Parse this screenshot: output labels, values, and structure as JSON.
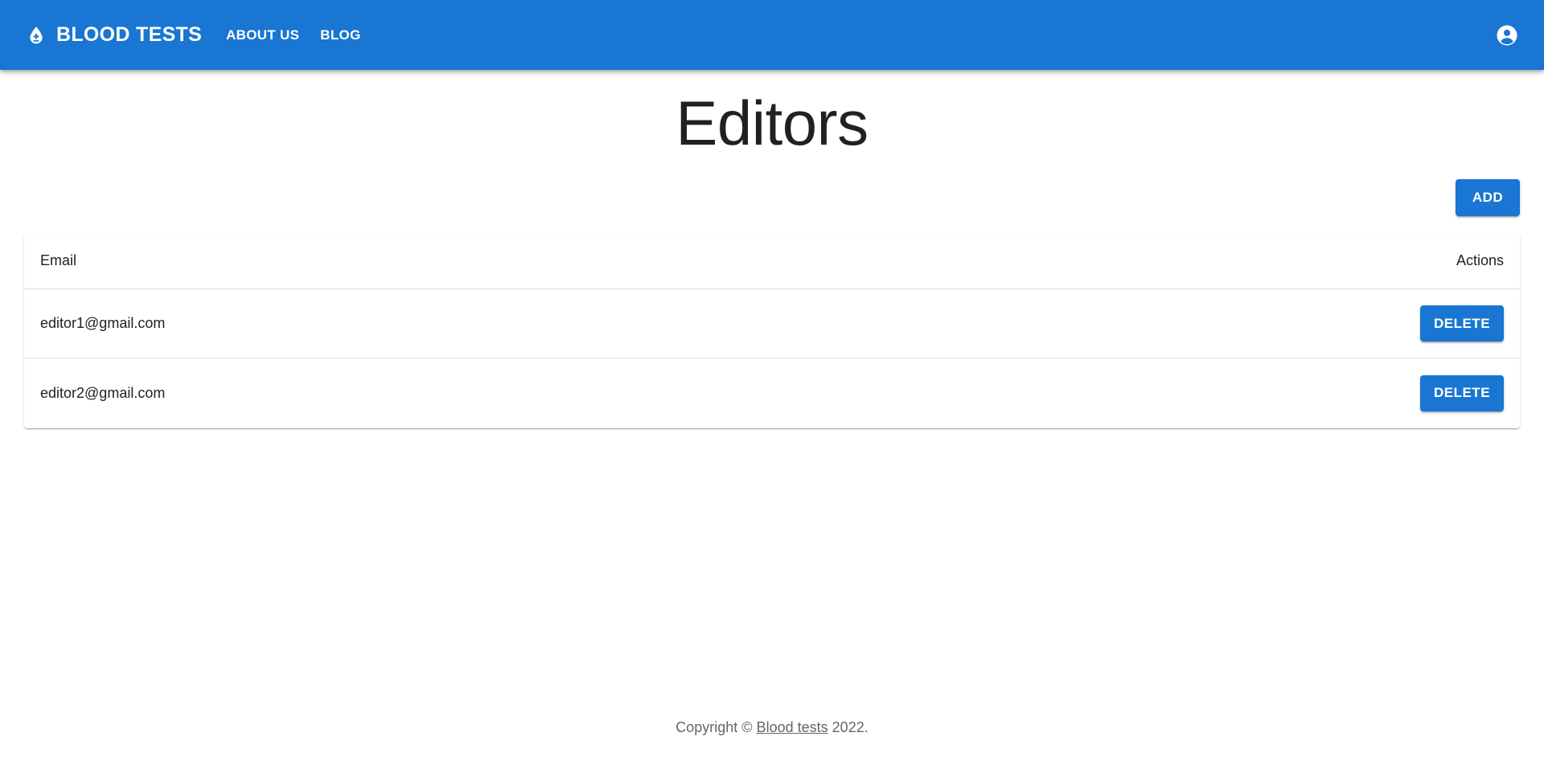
{
  "header": {
    "brand_title": "BLOOD TESTS",
    "nav": [
      {
        "label": "ABOUT US"
      },
      {
        "label": "BLOG"
      }
    ],
    "brand_color": "#1976d2"
  },
  "main": {
    "title": "Editors",
    "add_label": "ADD",
    "table": {
      "columns": [
        "Email",
        "Actions"
      ],
      "rows": [
        {
          "email": "editor1@gmail.com",
          "action_label": "DELETE"
        },
        {
          "email": "editor2@gmail.com",
          "action_label": "DELETE"
        }
      ]
    }
  },
  "footer": {
    "prefix": "Copyright ©",
    "link_text": "Blood tests",
    "suffix": "2022."
  },
  "icons": {
    "brand": "blood-drop-icon",
    "account": "account-circle-icon"
  }
}
